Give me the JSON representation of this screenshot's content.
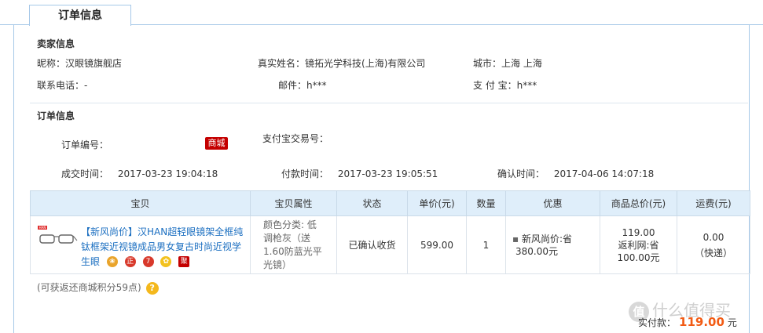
{
  "tab": {
    "label": "订单信息"
  },
  "seller": {
    "title": "卖家信息",
    "nickname_label": "昵称：",
    "nickname": "汉眼镜旗舰店",
    "realname_label": "真实姓名：",
    "realname": "镜拓光学科技(上海)有限公司",
    "city_label": "城市：",
    "city": "上海 上海",
    "phone_label": "联系电话：",
    "phone": "-",
    "email_label": "邮件：",
    "email": "h***",
    "alipay_label": "支 付 宝：",
    "alipay": "h***"
  },
  "order": {
    "title": "订单信息",
    "order_no_label": "订单编号：",
    "mall_badge": "商城",
    "alipay_trade_label": "支付宝交易号：",
    "deal_time_label": "成交时间：",
    "deal_time": "2017-03-23 19:04:18",
    "pay_time_label": "付款时间：",
    "pay_time": "2017-03-23 19:05:51",
    "confirm_time_label": "确认时间：",
    "confirm_time": "2017-04-06 14:07:18"
  },
  "table": {
    "headers": [
      "宝贝",
      "宝贝属性",
      "状态",
      "单价(元)",
      "数量",
      "优惠",
      "商品总价(元)",
      "运费(元)"
    ],
    "row": {
      "title": "【新风尚价】汉HAN超轻眼镜架全框纯钛框架近视镜成品男女复古时尚近视学生眼",
      "ju_icon": "聚",
      "attr": "颜色分类: 低调枪灰（送1.60防蓝光平光镜）",
      "status": "已确认收货",
      "price": "599.00",
      "qty": "1",
      "discount_line1": "新风尚价:省",
      "discount_line2": "380.00元",
      "total_line1": "119.00",
      "total_line2": "返利网:省",
      "total_line3": "100.00元",
      "ship_line1": "0.00",
      "ship_line2": "（快递）"
    }
  },
  "points": {
    "text": "(可获返还商城积分59点)",
    "help_icon": "?"
  },
  "paid": {
    "label": "实付款：",
    "amount": "119.00",
    "unit": "元"
  },
  "watermark": {
    "icon": "值",
    "text": "什么值得买"
  }
}
